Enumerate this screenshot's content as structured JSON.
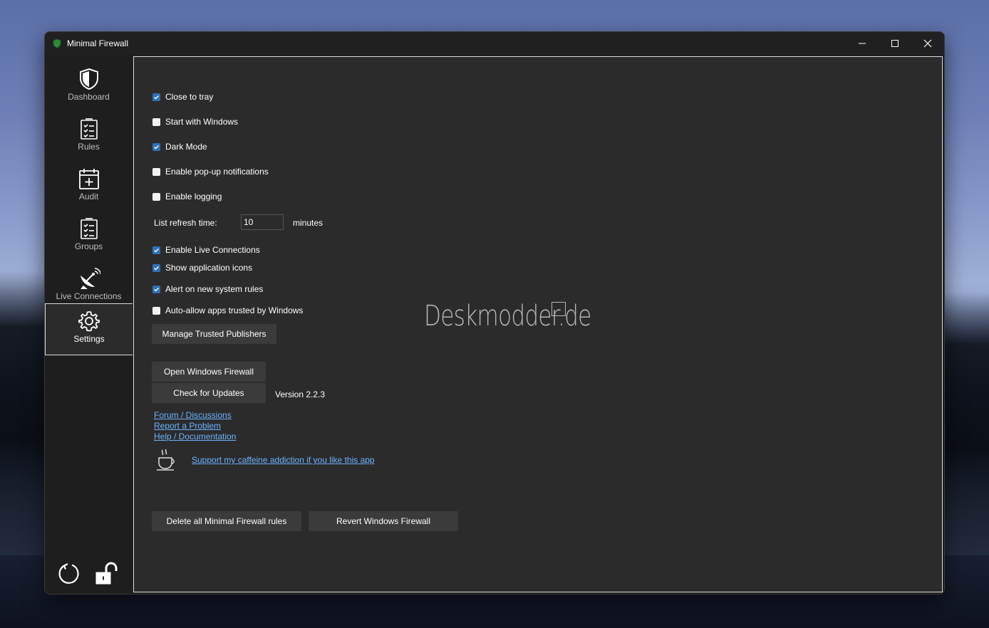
{
  "window": {
    "title": "Minimal Firewall"
  },
  "sidebar": {
    "items": [
      {
        "label": "Dashboard",
        "icon": "shield-icon"
      },
      {
        "label": "Rules",
        "icon": "checklist-icon"
      },
      {
        "label": "Audit",
        "icon": "calendar-add-icon"
      },
      {
        "label": "Groups",
        "icon": "checklist-icon"
      },
      {
        "label": "Live Connections",
        "icon": "satellite-dish-icon"
      },
      {
        "label": "Settings",
        "icon": "gear-icon",
        "active": true
      }
    ],
    "bottom_icons": [
      "refresh-icon",
      "unlock-icon"
    ]
  },
  "settings": {
    "close_to_tray": {
      "label": "Close to tray",
      "checked": true
    },
    "start_with_windows": {
      "label": "Start with Windows",
      "checked": false
    },
    "dark_mode": {
      "label": "Dark Mode",
      "checked": true
    },
    "popup_notifications": {
      "label": "Enable pop-up notifications",
      "checked": false
    },
    "logging": {
      "label": "Enable logging",
      "checked": false
    },
    "refresh": {
      "label": "List refresh time:",
      "value": "10",
      "unit": "minutes"
    },
    "live_connections": {
      "label": "Enable Live Connections",
      "checked": true
    },
    "app_icons": {
      "label": "Show application icons",
      "checked": true
    },
    "alert_system_rules": {
      "label": "Alert on new system rules",
      "checked": true
    },
    "auto_allow": {
      "label": "Auto-allow apps trusted by Windows",
      "checked": false
    },
    "manage_publishers": "Manage Trusted Publishers",
    "open_firewall": "Open Windows Firewall",
    "check_updates": "Check for Updates",
    "version": "Version 2.2.3",
    "links": {
      "forum": "Forum / Discussions",
      "report": "Report a Problem",
      "help": "Help / Documentation",
      "support": "Support my caffeine addiction if you like this app"
    },
    "delete_rules": "Delete all Minimal Firewall rules",
    "revert_firewall": "Revert Windows Firewall"
  },
  "watermark": "Deskmodder.de",
  "colors": {
    "accent": "#2f6fb8",
    "link": "#6cb4ff",
    "background": "#2b2b2b"
  }
}
